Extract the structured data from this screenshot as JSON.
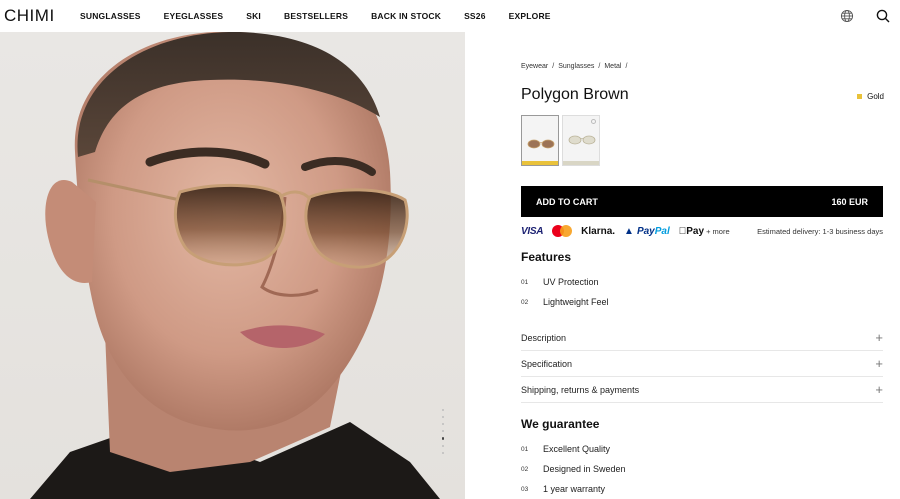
{
  "brand": {
    "logo": "CHIMI"
  },
  "nav": [
    "SUNGLASSES",
    "EYEGLASSES",
    "SKI",
    "BESTSELLERS",
    "BACK IN STOCK",
    "SS26",
    "EXPLORE"
  ],
  "header_icons": {
    "locale": "globe-icon",
    "search": "search-icon"
  },
  "breadcrumb": [
    "Eyewear",
    "Sunglasses",
    "Metal"
  ],
  "breadcrumb_sep": "/",
  "product": {
    "name": "Polygon Brown",
    "color_name": "Gold",
    "color_hex": "#e9c23a",
    "thumbnail_count": 2
  },
  "cart": {
    "label": "ADD TO CART",
    "price": "160 EUR"
  },
  "payments": {
    "visa": "VISA",
    "klarna": "Klarna.",
    "paypal_a": "Pay",
    "paypal_b": "Pal",
    "apple": "Pay",
    "more": "+ more"
  },
  "delivery": "Estimated delivery: 1-3 business days",
  "features": {
    "title": "Features",
    "items": [
      {
        "num": "01",
        "text": "UV Protection"
      },
      {
        "num": "02",
        "text": "Lightweight Feel"
      }
    ]
  },
  "accordions": [
    "Description",
    "Specification",
    "Shipping, returns & payments"
  ],
  "guarantee": {
    "title": "We guarantee",
    "items": [
      {
        "num": "01",
        "text": "Excellent Quality"
      },
      {
        "num": "02",
        "text": "Designed in Sweden"
      },
      {
        "num": "03",
        "text": "1 year warranty"
      }
    ]
  },
  "carousel": {
    "slides": 7,
    "active": 5
  }
}
